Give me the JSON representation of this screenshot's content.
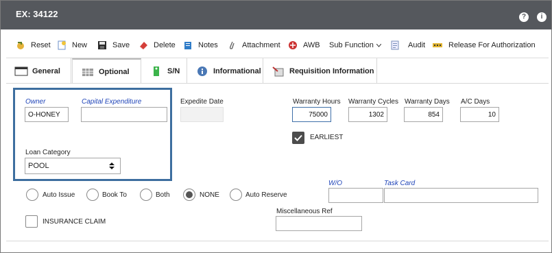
{
  "window": {
    "title": "EX: 34122"
  },
  "toolbar": {
    "reset": "Reset",
    "new": "New",
    "save": "Save",
    "delete": "Delete",
    "notes": "Notes",
    "attachment": "Attachment",
    "awb": "AWB",
    "sub_function": "Sub Function",
    "audit": "Audit",
    "release": "Release For Authorization"
  },
  "tabs": {
    "general": "General",
    "optional": "Optional",
    "sn": "S/N",
    "informational": "Informational",
    "requisition": "Requisition Information"
  },
  "form": {
    "owner_label": "Owner",
    "owner_value": "O-HONEY",
    "capex_label": "Capital Expenditure",
    "capex_value": "",
    "loan_category_label": "Loan Category",
    "loan_category_value": "POOL",
    "expedite_date_label": "Expedite Date",
    "warranty_hours_label": "Warranty Hours",
    "warranty_hours_value": "75000",
    "warranty_cycles_label": "Warranty Cycles",
    "warranty_cycles_value": "1302",
    "warranty_days_label": "Warranty Days",
    "warranty_days_value": "854",
    "ac_days_label": "A/C Days",
    "ac_days_value": "10",
    "earliest_label": "EARLIEST",
    "radio_auto_issue": "Auto Issue",
    "radio_book_to": "Book To",
    "radio_both": "Both",
    "radio_none": "NONE",
    "radio_auto_reserve": "Auto Reserve",
    "wo_label": "W/O",
    "task_card_label": "Task Card",
    "insurance_claim_label": "INSURANCE CLAIM",
    "misc_ref_label": "Miscellaneous Ref"
  },
  "colors": {
    "titlebar": "#55585d",
    "highlight_box": "#3d6e9f",
    "italic_label": "#1f44b8"
  }
}
